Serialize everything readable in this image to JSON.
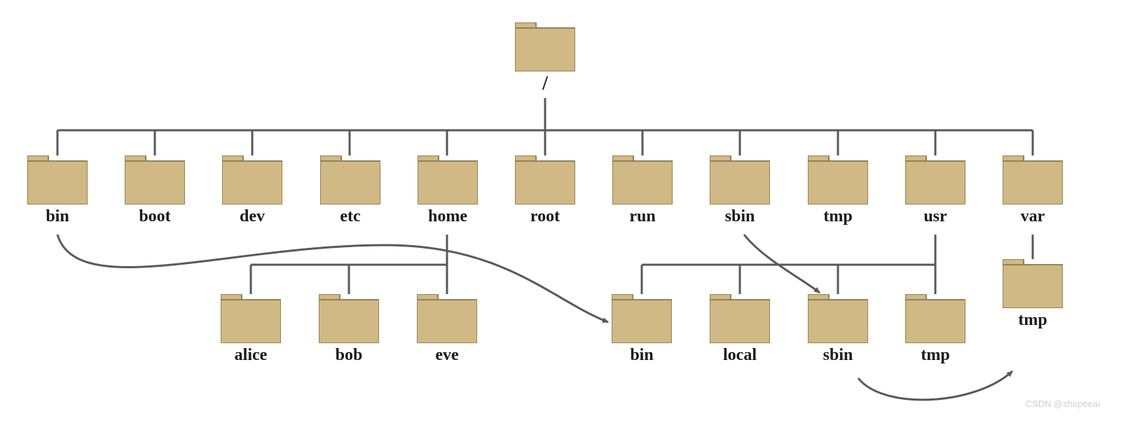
{
  "watermark": "CSDN @shopeeai",
  "colors": {
    "folder_fill": "#d1b985",
    "folder_stroke": "#938255",
    "line": "#595959"
  },
  "root": {
    "label": "/"
  },
  "level1": [
    {
      "id": "bin",
      "label": "bin"
    },
    {
      "id": "boot",
      "label": "boot"
    },
    {
      "id": "dev",
      "label": "dev"
    },
    {
      "id": "etc",
      "label": "etc"
    },
    {
      "id": "home",
      "label": "home"
    },
    {
      "id": "root",
      "label": "root"
    },
    {
      "id": "run",
      "label": "run"
    },
    {
      "id": "sbin",
      "label": "sbin"
    },
    {
      "id": "tmp",
      "label": "tmp"
    },
    {
      "id": "usr",
      "label": "usr"
    },
    {
      "id": "var",
      "label": "var"
    }
  ],
  "home_children": [
    {
      "id": "alice",
      "label": "alice"
    },
    {
      "id": "bob",
      "label": "bob"
    },
    {
      "id": "eve",
      "label": "eve"
    }
  ],
  "usr_children": [
    {
      "id": "usr_bin",
      "label": "bin"
    },
    {
      "id": "usr_local",
      "label": "local"
    },
    {
      "id": "usr_sbin",
      "label": "sbin"
    },
    {
      "id": "usr_tmp",
      "label": "tmp"
    }
  ],
  "var_children": [
    {
      "id": "var_tmp",
      "label": "tmp"
    }
  ],
  "symlinks": [
    {
      "from": "bin",
      "to": "usr_bin"
    },
    {
      "from": "sbin",
      "to": "usr_sbin"
    },
    {
      "from": "tmp",
      "to": "var_tmp"
    }
  ]
}
